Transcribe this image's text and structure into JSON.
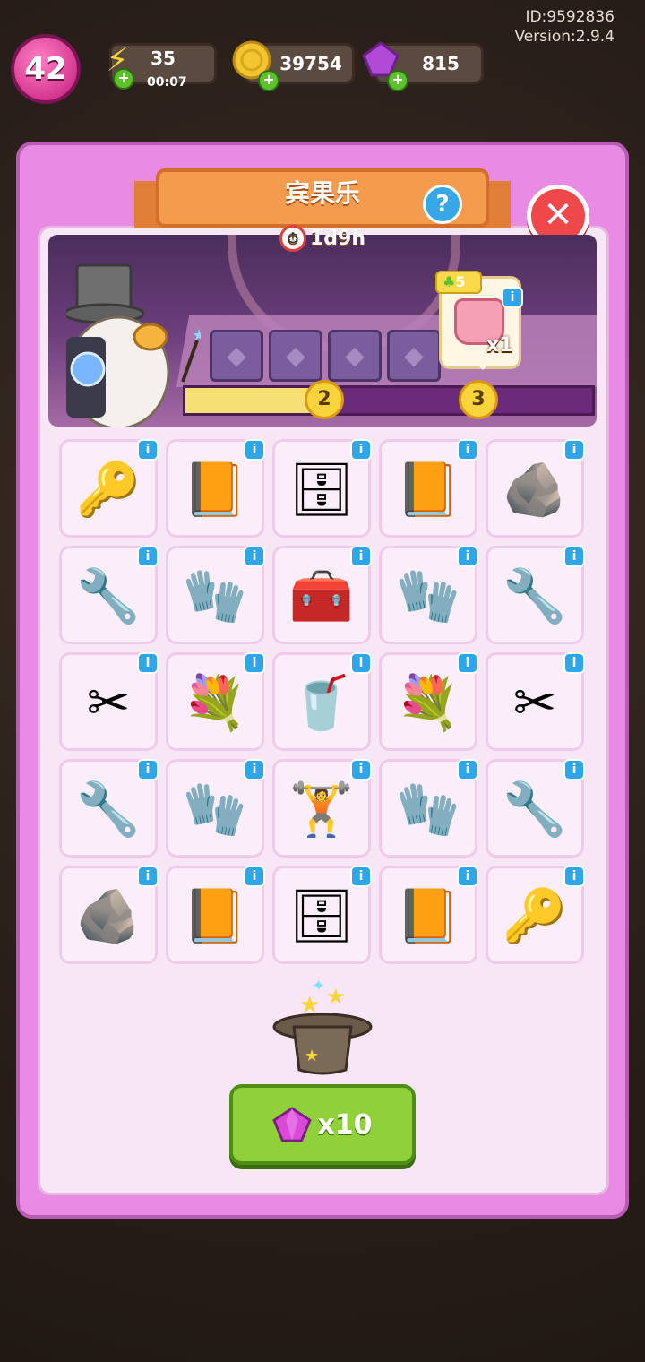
{
  "meta": {
    "id_text": "ID:9592836",
    "version_text": "Version:2.9.4"
  },
  "hud": {
    "level": "42",
    "energy": {
      "value": "35",
      "timer": "00:07",
      "icon": "lightning-icon"
    },
    "coins": {
      "value": "39754",
      "icon": "coin-icon"
    },
    "gems": {
      "value": "815",
      "icon": "gem-icon"
    }
  },
  "event": {
    "title": "宾果乐",
    "countdown": "1d9h",
    "progress_steps": [
      "2",
      "3"
    ],
    "progress_fraction": 0.32,
    "reward": {
      "clover_count": "5",
      "quantity": "x1",
      "icon": "pink-bag-icon"
    }
  },
  "grid": [
    [
      "key-tag",
      "orange-book",
      "wooden-cabinet",
      "orange-book",
      "rock-pile"
    ],
    [
      "green-wrench",
      "green-glove",
      "purple-tool-box",
      "green-glove",
      "green-wrench"
    ],
    [
      "green-pliers",
      "flower-crate",
      "shaker-bottle",
      "flower-crate",
      "green-pliers"
    ],
    [
      "green-wrench",
      "green-glove",
      "grip-trainer",
      "green-glove",
      "green-wrench"
    ],
    [
      "rock-pile",
      "orange-book",
      "wooden-cabinet",
      "orange-book",
      "key-tag"
    ]
  ],
  "buy": {
    "label": "x10",
    "icon": "gem-icon"
  },
  "colors": {
    "panel": "#e98be4",
    "accent": "#f59b4e",
    "button": "#8fd03b",
    "info": "#2fa6ea"
  }
}
